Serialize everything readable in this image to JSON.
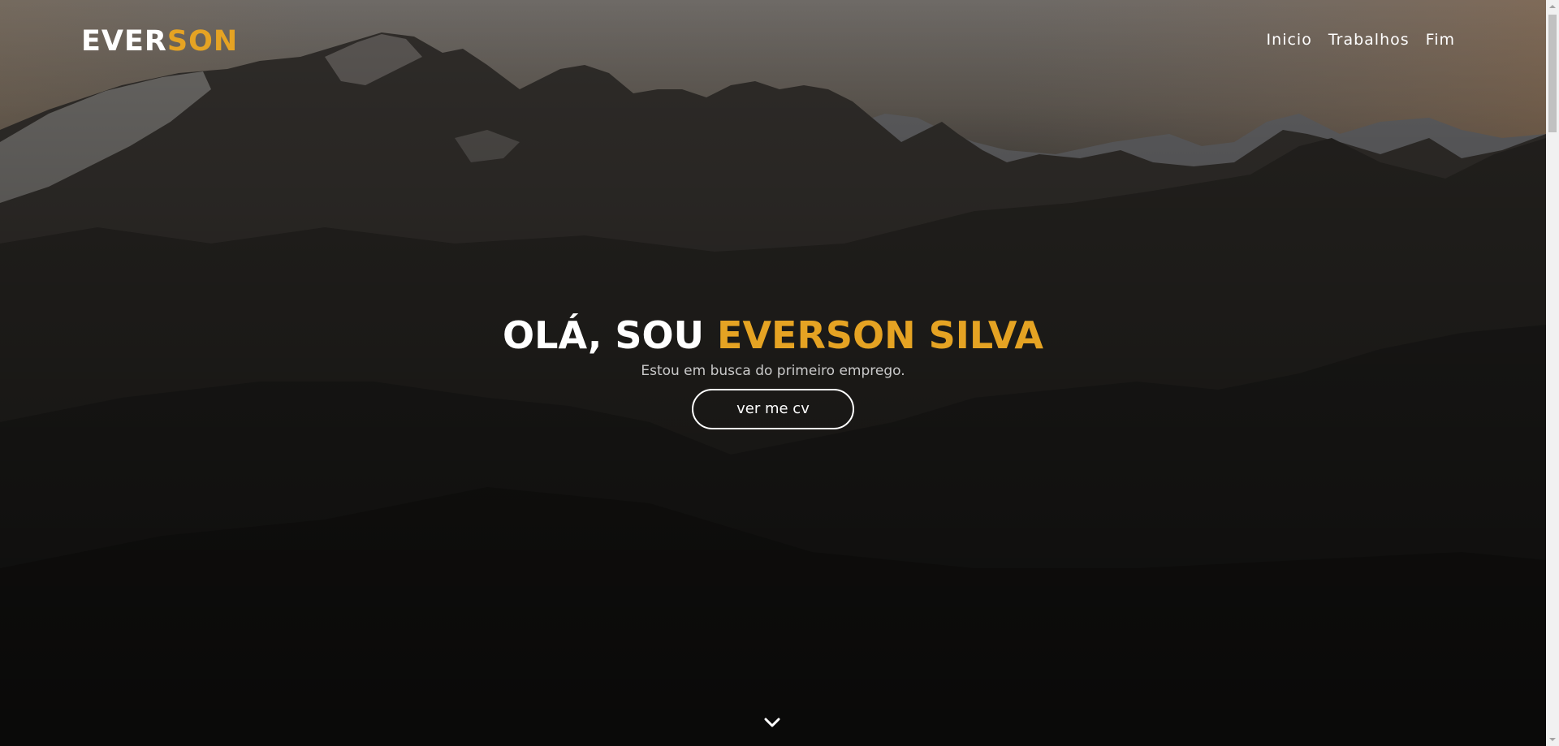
{
  "header": {
    "logo_primary": "EVER",
    "logo_accent": "SON"
  },
  "nav": {
    "items": [
      {
        "label": "Inicio"
      },
      {
        "label": "Trabalhos"
      },
      {
        "label": "Fim"
      }
    ]
  },
  "hero": {
    "title_prefix": "OLÁ, SOU ",
    "title_accent": "EVERSON SILVA",
    "subtitle": "Estou em busca do primeiro emprego.",
    "button_label": "ver me cv"
  },
  "icons": {
    "scroll_down": "chevron-down-icon"
  },
  "colors": {
    "accent": "#e5a323",
    "text": "#ffffff",
    "subtitle": "#c9c9c9",
    "overlay_dark": "#141311"
  }
}
